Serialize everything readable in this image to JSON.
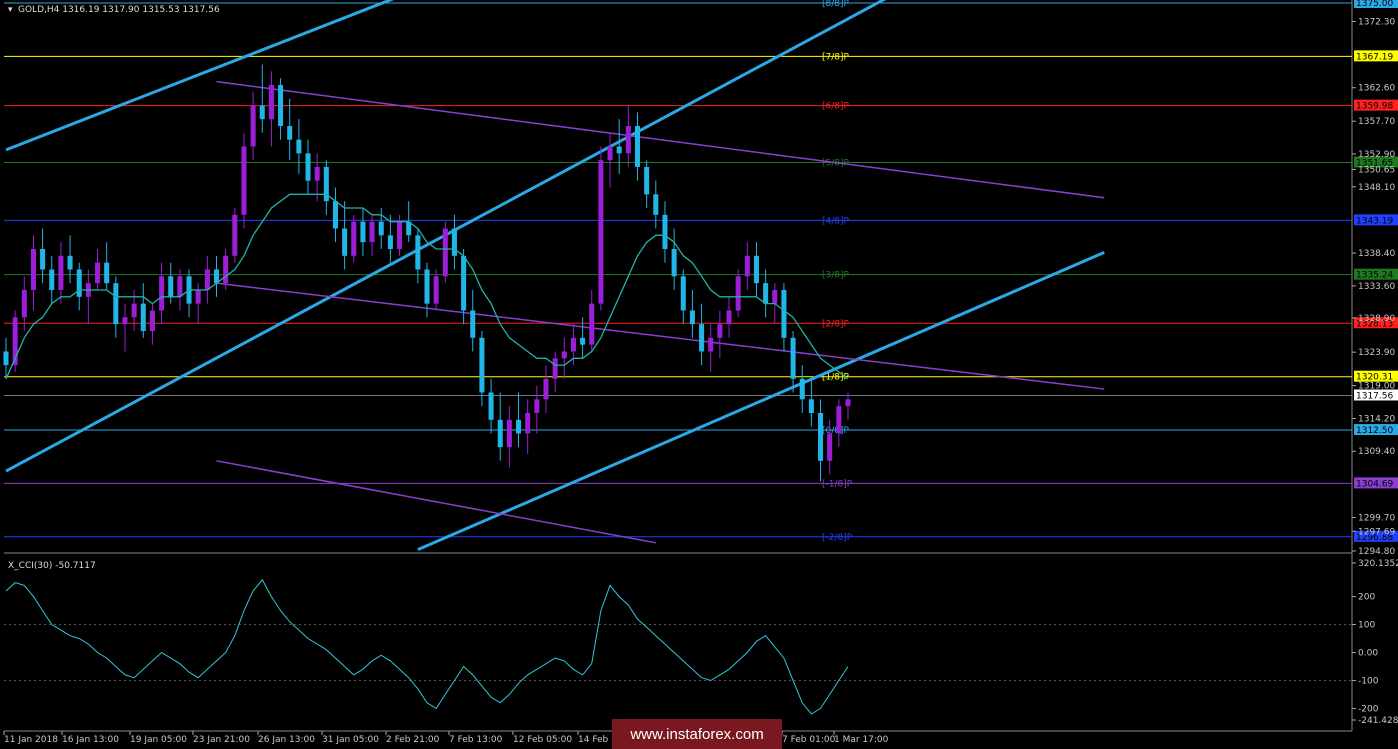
{
  "header": {
    "title": "GOLD,H4  1316.19 1317.90 1315.53 1317.56",
    "indicator_title": "X_CCI(30) -50.7117"
  },
  "watermark": "www.instaforex.com",
  "colors": {
    "background": "#000000",
    "grid": "#3a3a3a",
    "axis_text": "#c8c8c8",
    "bull_candle": "#9a1fd6",
    "bear_candle": "#22b5e8",
    "ma_line": "#20b2aa",
    "channel_blue": "#2aa9e6",
    "channel_violet": "#8a3fd0",
    "cci_line": "#30c8d8"
  },
  "chart_data": [
    {
      "type": "candlestick",
      "symbol": "GOLD",
      "timeframe": "H4",
      "last": {
        "open": 1316.19,
        "high": 1317.9,
        "low": 1315.53,
        "close": 1317.56
      },
      "ylim": [
        1294.8,
        1375.0
      ],
      "y_ticks": [
        "1375.00",
        "1372.30",
        "1367.19",
        "1362.60",
        "1359.98",
        "1357.70",
        "1352.90",
        "1350.65",
        "1348.10",
        "1343.19",
        "1338.40",
        "1335.24",
        "1333.60",
        "1328.90",
        "1328.13",
        "1323.90",
        "1320.31",
        "1319.00",
        "1317.56",
        "1314.20",
        "1312.50",
        "1309.40",
        "1304.69",
        "1299.70",
        "1297.69",
        "1294.80"
      ],
      "x_ticks": [
        "11 Jan 2018",
        "16 Jan 13:00",
        "19 Jan 05:00",
        "23 Jan 21:00",
        "26 Jan 13:00",
        "31 Jan 05:00",
        "2 Feb 21:00",
        "7 Feb 13:00",
        "12 Feb 05:00",
        "14 Feb",
        "7 Feb 01:00",
        "1 Mar 17:00"
      ],
      "murrey_levels": [
        {
          "label": "[8/8]P",
          "price": 1375.0,
          "color": "#2aa9e6",
          "tag": "1375.00"
        },
        {
          "label": "[7/8]P",
          "price": 1367.19,
          "color": "#ffff00",
          "tag": "1367.19"
        },
        {
          "label": "[6/8]P",
          "price": 1359.98,
          "color": "#ff2020",
          "tag": "1359.98"
        },
        {
          "label": "[5/8]P",
          "price": 1351.65,
          "color": "#1f7a1f",
          "tag": "1351.65"
        },
        {
          "label": "[4/8]P",
          "price": 1343.19,
          "color": "#2040ff",
          "tag": "1343.19"
        },
        {
          "label": "[3/8]P",
          "price": 1335.24,
          "color": "#1f7a1f",
          "tag": "1335.24"
        },
        {
          "label": "[2/8]P",
          "price": 1328.13,
          "color": "#ff2020",
          "tag": "1328.13"
        },
        {
          "label": "[1/8]P",
          "price": 1320.31,
          "color": "#ffff00",
          "tag": "1320.31"
        },
        {
          "label": "[0/8]P",
          "price": 1312.5,
          "color": "#2aa9e6",
          "tag": "1312.50"
        },
        {
          "label": "[-1/8]P",
          "price": 1304.69,
          "color": "#8a3fd0",
          "tag": "1304.69"
        },
        {
          "label": "[-2/8]P",
          "price": 1296.88,
          "color": "#2040ff",
          "tag": "1296.88"
        }
      ],
      "current_price_tag": "1317.56",
      "ohlc": [
        [
          1324,
          1326,
          1320,
          1322
        ],
        [
          1322,
          1330,
          1321,
          1329
        ],
        [
          1329,
          1335,
          1327,
          1333
        ],
        [
          1333,
          1341,
          1330,
          1339
        ],
        [
          1339,
          1342,
          1334,
          1336
        ],
        [
          1336,
          1338,
          1331,
          1333
        ],
        [
          1333,
          1340,
          1331,
          1338
        ],
        [
          1338,
          1341,
          1334,
          1336
        ],
        [
          1336,
          1337,
          1330,
          1332
        ],
        [
          1332,
          1336,
          1328,
          1334
        ],
        [
          1334,
          1339,
          1333,
          1337
        ],
        [
          1337,
          1340,
          1333,
          1334
        ],
        [
          1334,
          1335,
          1326,
          1328
        ],
        [
          1328,
          1331,
          1324,
          1329
        ],
        [
          1329,
          1333,
          1327,
          1331
        ],
        [
          1331,
          1334,
          1326,
          1327
        ],
        [
          1327,
          1331,
          1325,
          1330
        ],
        [
          1330,
          1337,
          1328,
          1335
        ],
        [
          1335,
          1337,
          1331,
          1332
        ],
        [
          1332,
          1336,
          1330,
          1335
        ],
        [
          1335,
          1336,
          1329,
          1331
        ],
        [
          1331,
          1334,
          1328,
          1333
        ],
        [
          1333,
          1338,
          1331,
          1336
        ],
        [
          1336,
          1338,
          1332,
          1334
        ],
        [
          1334,
          1339,
          1333,
          1338
        ],
        [
          1338,
          1345,
          1337,
          1344
        ],
        [
          1344,
          1356,
          1342,
          1354
        ],
        [
          1354,
          1362,
          1352,
          1360
        ],
        [
          1360,
          1366,
          1356,
          1358
        ],
        [
          1358,
          1365,
          1354,
          1363
        ],
        [
          1363,
          1364,
          1355,
          1357
        ],
        [
          1357,
          1361,
          1352,
          1355
        ],
        [
          1355,
          1358,
          1350,
          1353
        ],
        [
          1353,
          1355,
          1347,
          1349
        ],
        [
          1349,
          1353,
          1346,
          1351
        ],
        [
          1351,
          1352,
          1344,
          1346
        ],
        [
          1346,
          1348,
          1340,
          1342
        ],
        [
          1342,
          1346,
          1336,
          1338
        ],
        [
          1338,
          1344,
          1337,
          1343
        ],
        [
          1343,
          1345,
          1338,
          1340
        ],
        [
          1340,
          1344,
          1338,
          1343
        ],
        [
          1343,
          1345,
          1339,
          1341
        ],
        [
          1341,
          1344,
          1337,
          1339
        ],
        [
          1339,
          1344,
          1338,
          1343
        ],
        [
          1343,
          1346,
          1340,
          1341
        ],
        [
          1341,
          1342,
          1334,
          1336
        ],
        [
          1336,
          1337,
          1329,
          1331
        ],
        [
          1331,
          1336,
          1330,
          1335
        ],
        [
          1335,
          1343,
          1334,
          1342
        ],
        [
          1342,
          1344,
          1336,
          1338
        ],
        [
          1338,
          1339,
          1328,
          1330
        ],
        [
          1330,
          1333,
          1324,
          1326
        ],
        [
          1326,
          1327,
          1316,
          1318
        ],
        [
          1318,
          1320,
          1312,
          1314
        ],
        [
          1314,
          1318,
          1308,
          1310
        ],
        [
          1310,
          1316,
          1307,
          1314
        ],
        [
          1314,
          1318,
          1310,
          1312
        ],
        [
          1312,
          1317,
          1309,
          1315
        ],
        [
          1315,
          1319,
          1312,
          1317
        ],
        [
          1317,
          1322,
          1315,
          1320
        ],
        [
          1320,
          1324,
          1318,
          1323
        ],
        [
          1323,
          1326,
          1320,
          1324
        ],
        [
          1324,
          1328,
          1322,
          1326
        ],
        [
          1326,
          1329,
          1323,
          1325
        ],
        [
          1325,
          1333,
          1324,
          1331
        ],
        [
          1331,
          1354,
          1330,
          1352
        ],
        [
          1352,
          1356,
          1348,
          1354
        ],
        [
          1354,
          1358,
          1350,
          1353
        ],
        [
          1353,
          1360,
          1351,
          1357
        ],
        [
          1357,
          1359,
          1349,
          1351
        ],
        [
          1351,
          1352,
          1345,
          1347
        ],
        [
          1347,
          1349,
          1342,
          1344
        ],
        [
          1344,
          1346,
          1337,
          1339
        ],
        [
          1339,
          1342,
          1333,
          1335
        ],
        [
          1335,
          1336,
          1328,
          1330
        ],
        [
          1330,
          1333,
          1326,
          1328
        ],
        [
          1328,
          1331,
          1322,
          1324
        ],
        [
          1324,
          1328,
          1321,
          1326
        ],
        [
          1326,
          1330,
          1323,
          1328
        ],
        [
          1328,
          1332,
          1326,
          1330
        ],
        [
          1330,
          1336,
          1329,
          1335
        ],
        [
          1335,
          1340,
          1333,
          1338
        ],
        [
          1338,
          1340,
          1332,
          1334
        ],
        [
          1334,
          1336,
          1329,
          1331
        ],
        [
          1331,
          1334,
          1328,
          1333
        ],
        [
          1333,
          1334,
          1324,
          1326
        ],
        [
          1326,
          1327,
          1318,
          1320
        ],
        [
          1320,
          1322,
          1315,
          1317
        ],
        [
          1317,
          1320,
          1313,
          1315
        ],
        [
          1315,
          1317,
          1305,
          1308
        ],
        [
          1308,
          1314,
          1306,
          1312
        ],
        [
          1312,
          1317,
          1310,
          1316
        ],
        [
          1316,
          1318,
          1314,
          1317
        ]
      ],
      "moving_average": [
        1320,
        1323,
        1326,
        1328,
        1329,
        1331,
        1332,
        1332,
        1333,
        1333,
        1333,
        1333,
        1332,
        1332,
        1332,
        1332,
        1331,
        1332,
        1332,
        1332,
        1333,
        1333,
        1333,
        1334,
        1335,
        1336,
        1338,
        1341,
        1343,
        1345,
        1346,
        1347,
        1347,
        1347,
        1347,
        1347,
        1346,
        1345,
        1345,
        1345,
        1344,
        1344,
        1343,
        1343,
        1343,
        1342,
        1340,
        1339,
        1339,
        1339,
        1338,
        1336,
        1333,
        1331,
        1328,
        1326,
        1325,
        1324,
        1323,
        1323,
        1322,
        1322,
        1323,
        1323,
        1324,
        1326,
        1329,
        1332,
        1335,
        1338,
        1340,
        1341,
        1341,
        1340,
        1338,
        1337,
        1335,
        1333,
        1332,
        1332,
        1332,
        1332,
        1332,
        1331,
        1331,
        1330,
        1329,
        1327,
        1325,
        1323,
        1322,
        1321,
        1320
      ],
      "trend_lines": [
        {
          "name": "blue-channel-upper",
          "color": "#2aa9e6",
          "points": [
            [
              0,
              1353.5
            ],
            [
              44,
              1376.5
            ]
          ]
        },
        {
          "name": "blue-channel-middle",
          "color": "#2aa9e6",
          "points": [
            [
              0,
              1306.5
            ],
            [
              98,
              1377.0
            ]
          ]
        },
        {
          "name": "blue-channel-lower",
          "color": "#2aa9e6",
          "points": [
            [
              45,
              1295.0
            ],
            [
              120,
              1338.5
            ]
          ]
        },
        {
          "name": "violet-channel-upper",
          "color": "#8a3fd0",
          "points": [
            [
              23,
              1363.5
            ],
            [
              120,
              1346.5
            ]
          ]
        },
        {
          "name": "violet-channel-middle",
          "color": "#8a3fd0",
          "points": [
            [
              23,
              1334.0
            ],
            [
              120,
              1318.5
            ]
          ]
        },
        {
          "name": "violet-channel-lower",
          "color": "#8a3fd0",
          "points": [
            [
              23,
              1308.0
            ],
            [
              71,
              1296.0
            ]
          ]
        }
      ]
    },
    {
      "type": "line",
      "name": "X_CCI(30) -50.7117",
      "ylim": [
        -241.4283,
        320.1352
      ],
      "y_ticks": [
        "320.1352",
        "200",
        "100",
        "0.00",
        "-100",
        "-200",
        "-241.4283"
      ],
      "values": [
        220,
        250,
        240,
        200,
        150,
        100,
        80,
        60,
        50,
        30,
        0,
        -20,
        -50,
        -80,
        -90,
        -60,
        -30,
        0,
        -20,
        -40,
        -70,
        -90,
        -60,
        -30,
        0,
        60,
        150,
        220,
        260,
        200,
        150,
        110,
        80,
        50,
        30,
        10,
        -20,
        -50,
        -80,
        -60,
        -30,
        -10,
        -30,
        -60,
        -90,
        -130,
        -180,
        -200,
        -150,
        -100,
        -50,
        -80,
        -120,
        -160,
        -180,
        -150,
        -110,
        -80,
        -60,
        -40,
        -20,
        -30,
        -60,
        -80,
        -40,
        150,
        240,
        200,
        170,
        120,
        90,
        60,
        30,
        0,
        -30,
        -60,
        -90,
        -100,
        -80,
        -60,
        -30,
        0,
        40,
        60,
        20,
        -20,
        -100,
        -180,
        -220,
        -200,
        -150,
        -100,
        -50
      ]
    }
  ]
}
